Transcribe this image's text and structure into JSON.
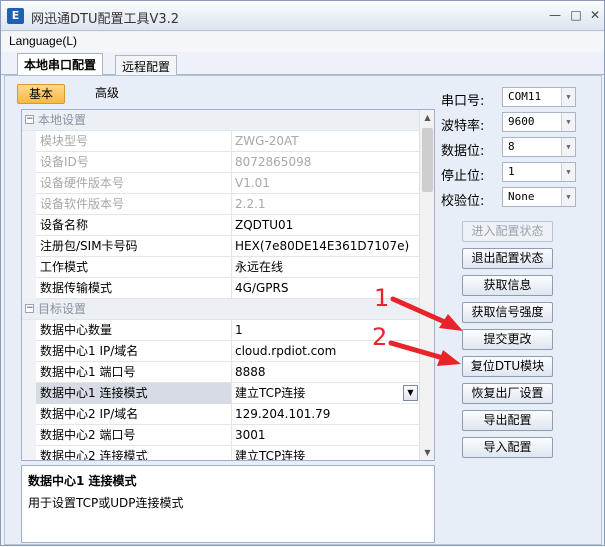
{
  "window": {
    "title": "网迅通DTU配置工具V3.2",
    "icon_text": "E"
  },
  "menu": {
    "language": "Language(L)"
  },
  "tabs": [
    "本地串口配置",
    "远程配置"
  ],
  "subtabs": [
    "基本",
    "高级"
  ],
  "grid": {
    "categories": {
      "local": "本地设置",
      "target": "目标设置"
    },
    "local_rows": [
      {
        "name": "模块型号",
        "value": "ZWG-20AT"
      },
      {
        "name": "设备ID号",
        "value": "8072865098"
      },
      {
        "name": "设备硬件版本号",
        "value": "V1.01"
      },
      {
        "name": "设备软件版本号",
        "value": "2.2.1"
      },
      {
        "name": "设备名称",
        "value": "ZQDTU01"
      },
      {
        "name": "注册包/SIM卡号码",
        "value": "HEX(7e80DE14E361D7107e)"
      },
      {
        "name": "工作模式",
        "value": "永远在线"
      },
      {
        "name": "数据传输模式",
        "value": "4G/GPRS"
      }
    ],
    "target_rows": [
      {
        "name": "数据中心数量",
        "value": "1"
      },
      {
        "name": "数据中心1 IP/域名",
        "value": "cloud.rpdiot.com"
      },
      {
        "name": "数据中心1 端口号",
        "value": "8888"
      },
      {
        "name": "数据中心1 连接模式",
        "value": "建立TCP连接"
      },
      {
        "name": "数据中心2 IP/域名",
        "value": "129.204.101.79"
      },
      {
        "name": "数据中心2 端口号",
        "value": "3001"
      },
      {
        "name": "数据中心2 连接模式",
        "value": "建立TCP连接"
      }
    ]
  },
  "description": {
    "title": "数据中心1 连接模式",
    "text": "用于设置TCP或UDP连接模式"
  },
  "serial": {
    "port_label": "串口号:",
    "port_value": "COM11",
    "baud_label": "波特率:",
    "baud_value": "9600",
    "databits_label": "数据位:",
    "databits_value": "8",
    "stopbits_label": "停止位:",
    "stopbits_value": "1",
    "parity_label": "校验位:",
    "parity_value": "None"
  },
  "buttons": [
    "进入配置状态",
    "退出配置状态",
    "获取信息",
    "获取信号强度",
    "提交更改",
    "复位DTU模块",
    "恢复出厂设置",
    "导出配置",
    "导入配置"
  ],
  "annotations": {
    "arrow1_label": "1",
    "arrow2_label": "2",
    "color": "#e8232a"
  }
}
